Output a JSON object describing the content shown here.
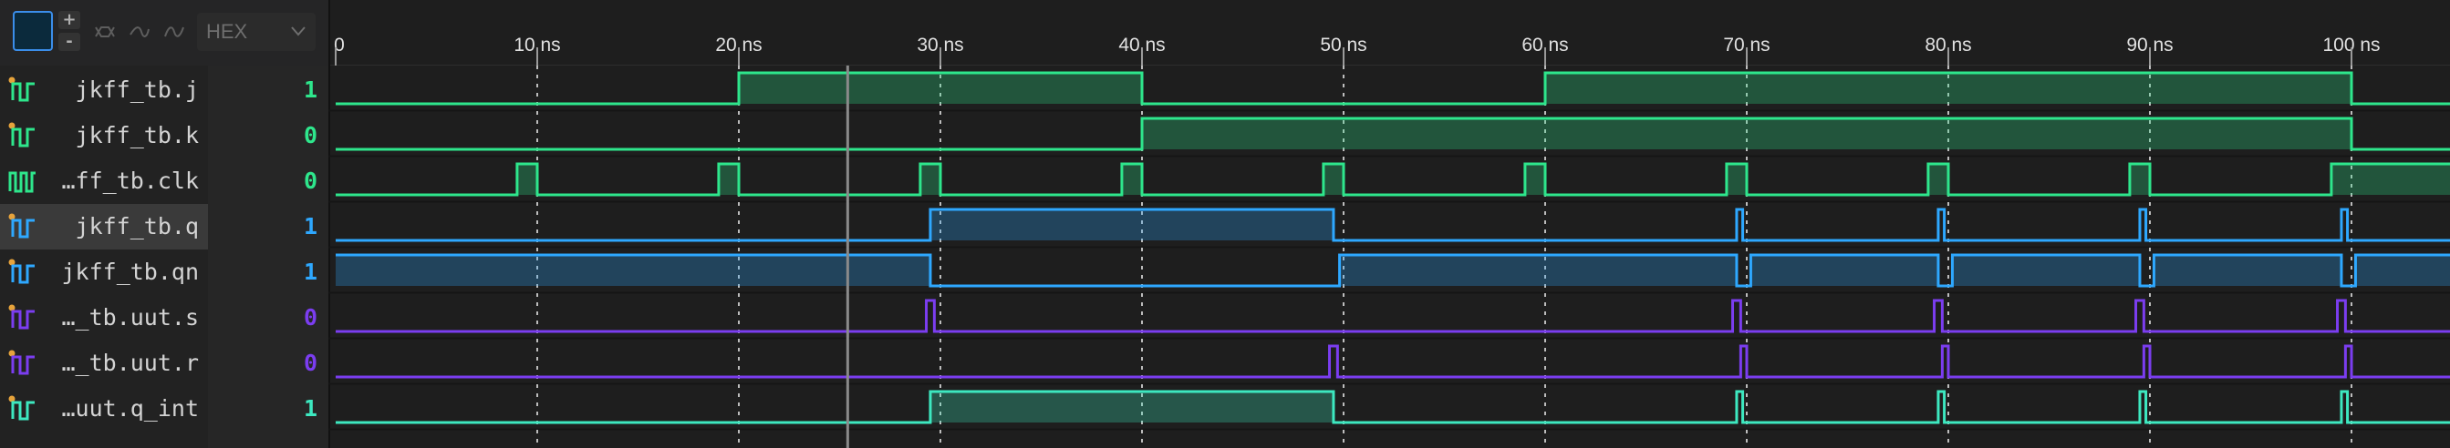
{
  "toolbar": {
    "zoom_in": "+",
    "zoom_out": "-",
    "radix": "HEX"
  },
  "ruler": {
    "ticks": [
      {
        "t": 0,
        "label": "0"
      },
      {
        "t": 10,
        "label": "10 ns"
      },
      {
        "t": 20,
        "label": "20 ns"
      },
      {
        "t": 30,
        "label": "30 ns"
      },
      {
        "t": 40,
        "label": "40 ns"
      },
      {
        "t": 50,
        "label": "50 ns"
      },
      {
        "t": 60,
        "label": "60 ns"
      },
      {
        "t": 70,
        "label": "70 ns"
      },
      {
        "t": 80,
        "label": "80 ns"
      },
      {
        "t": 90,
        "label": "90 ns"
      },
      {
        "t": 100,
        "label": "100 ns"
      }
    ],
    "cursor_ns": 25.4
  },
  "colors": {
    "green": "#2ee68c",
    "blue": "#2ea8ff",
    "purple": "#7b3df0",
    "teal": "#3de8c0",
    "orange": "#e6a33b"
  },
  "signals": [
    {
      "name": "jkff_tb.j",
      "value": "1",
      "color": "green",
      "icon": "bit-signal-icon",
      "edges": [
        [
          0,
          0
        ],
        [
          20,
          1
        ],
        [
          40,
          0
        ],
        [
          60,
          1
        ],
        [
          100,
          0
        ]
      ]
    },
    {
      "name": "jkff_tb.k",
      "value": "0",
      "color": "green",
      "icon": "bit-signal-icon",
      "edges": [
        [
          0,
          0
        ],
        [
          40,
          1
        ],
        [
          100,
          0
        ]
      ]
    },
    {
      "name": "…ff_tb.clk",
      "value": "0",
      "color": "green",
      "icon": "clock-signal-icon",
      "edges": [
        [
          0,
          0
        ],
        [
          9,
          1
        ],
        [
          10,
          0
        ],
        [
          19,
          1
        ],
        [
          20,
          0
        ],
        [
          29,
          1
        ],
        [
          30,
          0
        ],
        [
          39,
          1
        ],
        [
          40,
          0
        ],
        [
          49,
          1
        ],
        [
          50,
          0
        ],
        [
          59,
          1
        ],
        [
          60,
          0
        ],
        [
          69,
          1
        ],
        [
          70,
          0
        ],
        [
          79,
          1
        ],
        [
          80,
          0
        ],
        [
          89,
          1
        ],
        [
          90,
          0
        ],
        [
          99,
          1
        ]
      ]
    },
    {
      "name": "jkff_tb.q",
      "value": "1",
      "color": "blue",
      "icon": "bit-signal-icon",
      "selected": true,
      "edges": [
        [
          0,
          0
        ],
        [
          29.5,
          1
        ],
        [
          49.5,
          0
        ],
        [
          69.5,
          1
        ],
        [
          69.8,
          0
        ],
        [
          79.5,
          1
        ],
        [
          79.8,
          0
        ],
        [
          89.5,
          1
        ],
        [
          89.8,
          0
        ],
        [
          99.5,
          1
        ],
        [
          99.8,
          0
        ]
      ]
    },
    {
      "name": "jkff_tb.qn",
      "value": "1",
      "color": "blue",
      "icon": "bit-signal-icon",
      "edges": [
        [
          0,
          1
        ],
        [
          29.5,
          0
        ],
        [
          49.8,
          1
        ],
        [
          69.5,
          0
        ],
        [
          70.2,
          1
        ],
        [
          79.5,
          0
        ],
        [
          80.2,
          1
        ],
        [
          89.5,
          0
        ],
        [
          90.2,
          1
        ],
        [
          99.5,
          0
        ],
        [
          100.2,
          1
        ]
      ]
    },
    {
      "name": "…_tb.uut.s",
      "value": "0",
      "color": "purple",
      "icon": "bit-signal-icon",
      "edges": [
        [
          0,
          0
        ],
        [
          29.3,
          1
        ],
        [
          29.7,
          0
        ],
        [
          69.3,
          1
        ],
        [
          69.7,
          0
        ],
        [
          79.3,
          1
        ],
        [
          79.7,
          0
        ],
        [
          89.3,
          1
        ],
        [
          89.7,
          0
        ],
        [
          99.3,
          1
        ],
        [
          99.7,
          0
        ]
      ]
    },
    {
      "name": "…_tb.uut.r",
      "value": "0",
      "color": "purple",
      "icon": "bit-signal-icon",
      "edges": [
        [
          0,
          0
        ],
        [
          49.3,
          1
        ],
        [
          49.7,
          0
        ],
        [
          69.7,
          1
        ],
        [
          70.0,
          0
        ],
        [
          79.7,
          1
        ],
        [
          80.0,
          0
        ],
        [
          89.7,
          1
        ],
        [
          90.0,
          0
        ],
        [
          99.7,
          1
        ],
        [
          100.0,
          0
        ]
      ]
    },
    {
      "name": "…uut.q_int",
      "value": "1",
      "color": "teal",
      "icon": "bit-signal-icon",
      "edges": [
        [
          0,
          0
        ],
        [
          29.5,
          1
        ],
        [
          49.5,
          0
        ],
        [
          69.5,
          1
        ],
        [
          69.8,
          0
        ],
        [
          79.5,
          1
        ],
        [
          79.8,
          0
        ],
        [
          89.5,
          1
        ],
        [
          89.8,
          0
        ],
        [
          99.5,
          1
        ],
        [
          99.8,
          0
        ]
      ]
    }
  ]
}
